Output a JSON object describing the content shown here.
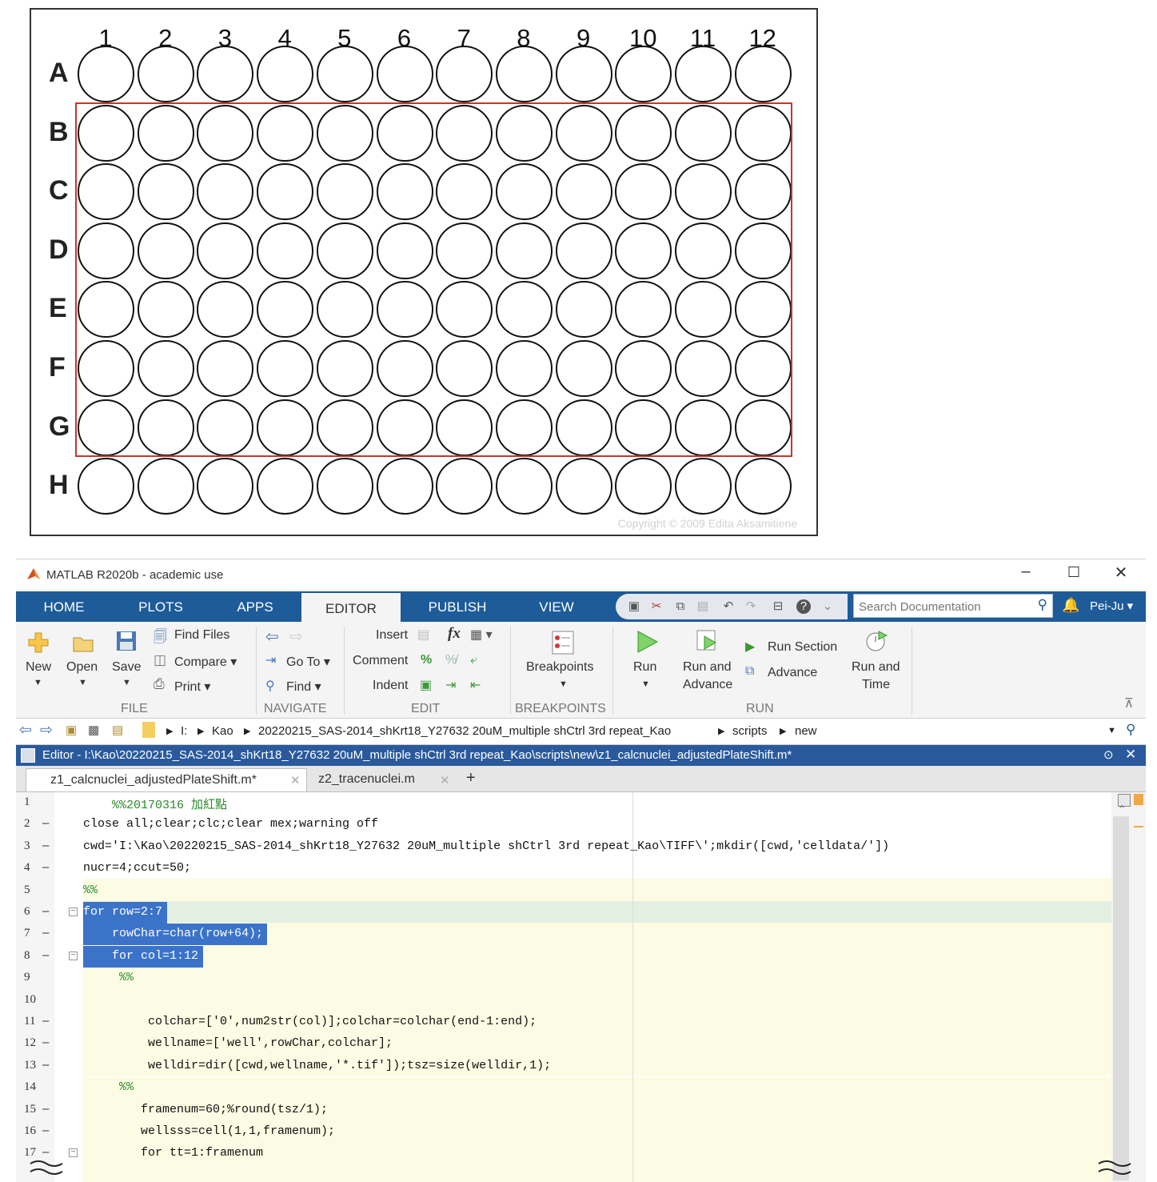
{
  "plate": {
    "columns": [
      "1",
      "2",
      "3",
      "4",
      "5",
      "6",
      "7",
      "8",
      "9",
      "10",
      "11",
      "12"
    ],
    "rows": [
      "A",
      "B",
      "C",
      "D",
      "E",
      "F",
      "G",
      "H"
    ],
    "selection_color": "#c0392b",
    "selected_rows": "B–G",
    "copyright": "Copyright © 2009 Edita Aksamitiene"
  },
  "window": {
    "title": "MATLAB R2020b - academic use",
    "controls": [
      "–",
      "☐",
      "✕"
    ]
  },
  "tabs": [
    {
      "label": "HOME"
    },
    {
      "label": "PLOTS"
    },
    {
      "label": "APPS"
    },
    {
      "label": "EDITOR",
      "active": true
    },
    {
      "label": "PUBLISH"
    },
    {
      "label": "VIEW"
    }
  ],
  "search": {
    "placeholder": "Search Documentation"
  },
  "user": "Pei-Ju ▾",
  "ribbon": {
    "file": {
      "new": "New",
      "open": "Open",
      "save": "Save",
      "find_files": "Find Files",
      "compare": "Compare ▾",
      "print": "Print ▾",
      "category": "FILE"
    },
    "navigate": {
      "goto": "Go To ▾",
      "find": "Find ▾",
      "category": "NAVIGATE"
    },
    "edit": {
      "insert": "Insert",
      "comment": "Comment",
      "indent": "Indent",
      "category": "EDIT"
    },
    "breakpoints": {
      "label": "Breakpoints",
      "category": "BREAKPOINTS"
    },
    "run": {
      "run": "Run",
      "run_advance_1": "Run and",
      "run_advance_2": "Advance",
      "run_section": "Run Section",
      "advance": "Advance",
      "run_time_1": "Run and",
      "run_time_2": "Time",
      "category": "RUN"
    }
  },
  "path": {
    "crumbs": [
      "I:",
      "Kao",
      "20220215_SAS-2014_shKrt18_Y27632 20uM_multiple shCtrl 3rd repeat_Kao",
      "scripts",
      "new"
    ]
  },
  "editor": {
    "title": "Editor - I:\\Kao\\20220215_SAS-2014_shKrt18_Y27632 20uM_multiple shCtrl 3rd repeat_Kao\\scripts\\new\\z1_calcnuclei_adjustedPlateShift.m*",
    "tabs": [
      "z1_calcnuclei_adjustedPlateShift.m*",
      "z2_tracenuclei.m"
    ],
    "tab_add": "+"
  },
  "code_lines": [
    {
      "n": "1",
      "dash": "",
      "text": "    %%20170316 加紅點"
    },
    {
      "n": "2",
      "dash": "–",
      "text": "close all;clear;clc;clear mex;warning off"
    },
    {
      "n": "3",
      "dash": "–",
      "text": "cwd='I:\\Kao\\20220215_SAS-2014_shKrt18_Y27632 20uM_multiple shCtrl 3rd repeat_Kao\\TIFF\\';mkdir([cwd,'celldata/'])"
    },
    {
      "n": "4",
      "dash": "–",
      "text": "nucr=4;ccut=50;"
    },
    {
      "n": "5",
      "dash": "",
      "text": "%%"
    },
    {
      "n": "6",
      "dash": "–",
      "text": "for row=2:7"
    },
    {
      "n": "7",
      "dash": "–",
      "text": "    rowChar=char(row+64);"
    },
    {
      "n": "8",
      "dash": "–",
      "text": "    for col=1:12"
    },
    {
      "n": "9",
      "dash": "",
      "text": "     %%"
    },
    {
      "n": "10",
      "dash": "",
      "text": ""
    },
    {
      "n": "11",
      "dash": "–",
      "text": "         colchar=['0',num2str(col)];colchar=colchar(end-1:end);"
    },
    {
      "n": "12",
      "dash": "–",
      "text": "         wellname=['well',rowChar,colchar];"
    },
    {
      "n": "13",
      "dash": "–",
      "text": "         welldir=dir([cwd,wellname,'*.tif']);tsz=size(welldir,1);"
    },
    {
      "n": "14",
      "dash": "",
      "text": "     %%"
    },
    {
      "n": "15",
      "dash": "–",
      "text": "        framenum=60;%round(tsz/1);"
    },
    {
      "n": "16",
      "dash": "–",
      "text": "        wellsss=cell(1,1,framenum);"
    },
    {
      "n": "17",
      "dash": "–",
      "text": "        for tt=1:framenum"
    }
  ]
}
